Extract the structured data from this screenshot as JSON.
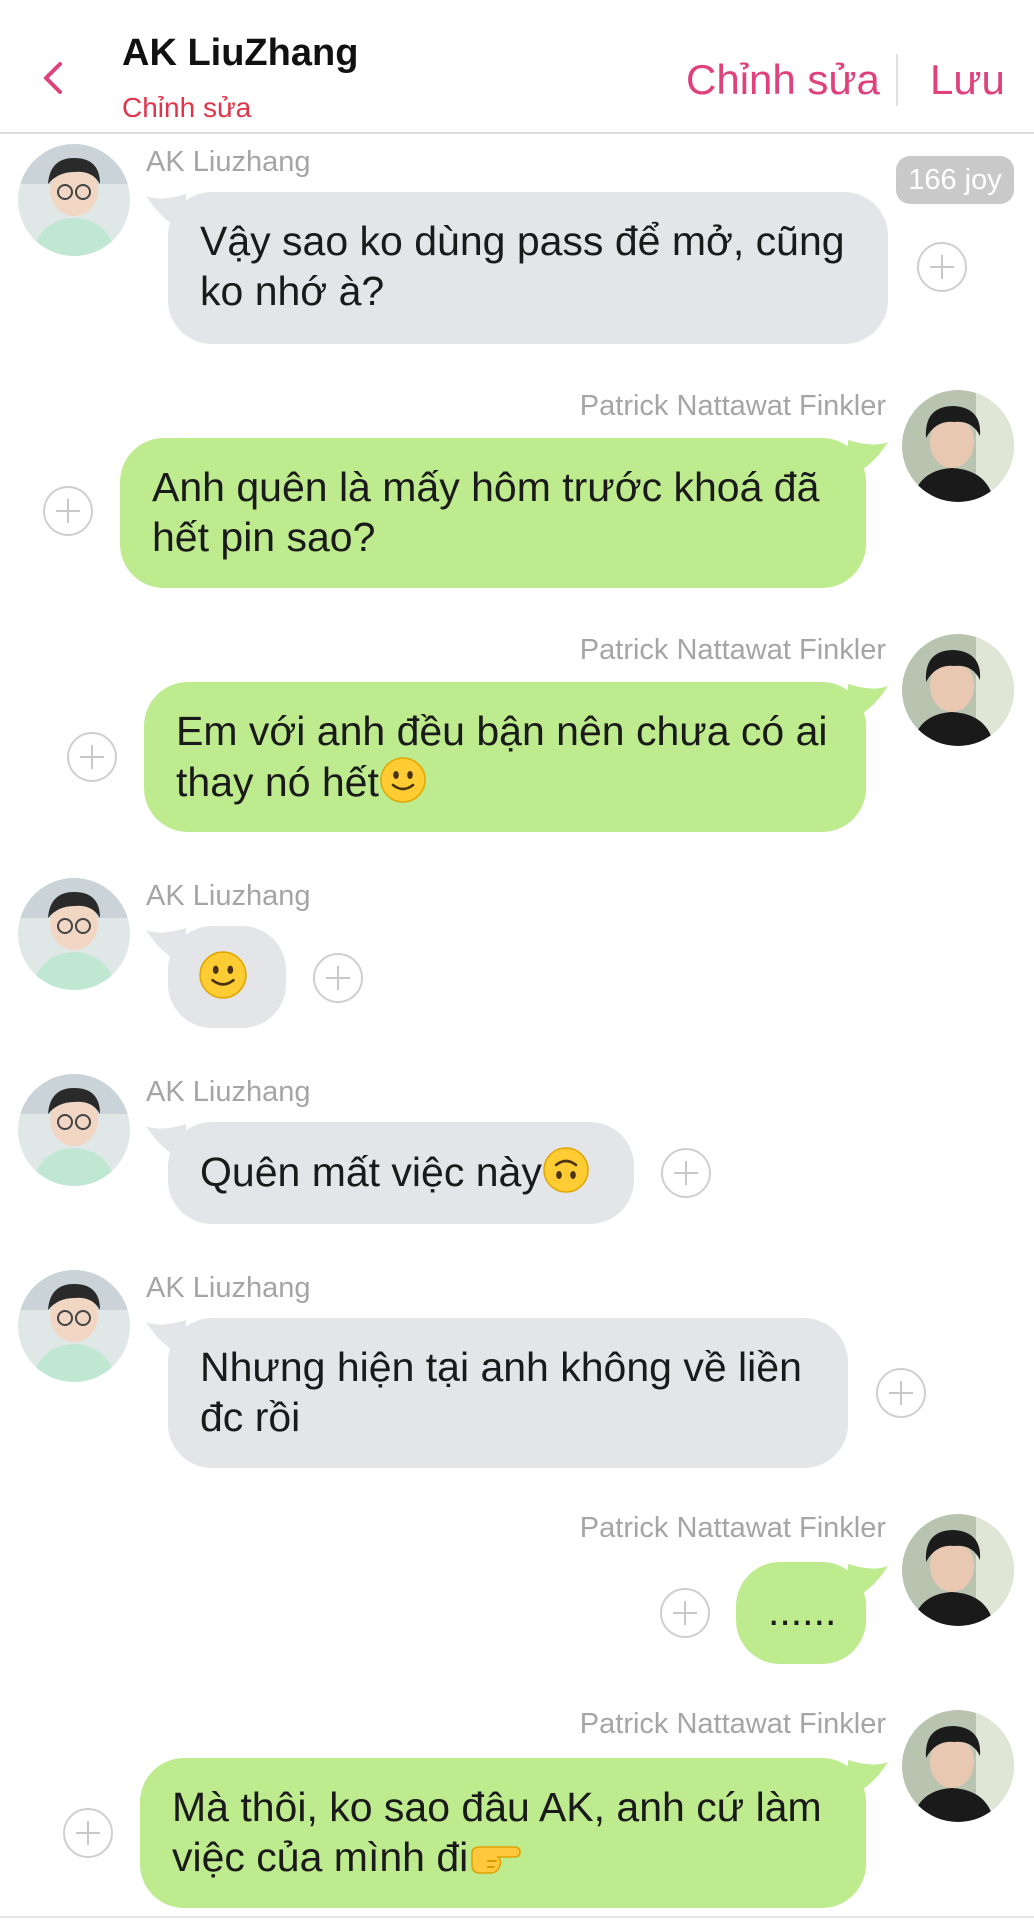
{
  "header": {
    "contact_name": "AK LiuZhang",
    "subtitle": "Chỉnh sửa",
    "edit_label": "Chỉnh sửa",
    "save_label": "Lưu"
  },
  "joy_badge": "166 joy",
  "messages": [
    {
      "sender": "AK Liuzhang",
      "side": "left",
      "lines": [
        "Vậy sao ko dùng pass để mở, cũng",
        "ko nhớ à?"
      ]
    },
    {
      "sender": "Patrick Nattawat Finkler",
      "side": "right",
      "lines": [
        "Anh quên là mấy hôm trước khoá đã",
        "hết pin sao?"
      ]
    },
    {
      "sender": "Patrick Nattawat Finkler",
      "side": "right",
      "lines": [
        "Em với anh đều bận nên chưa có ai",
        "thay nó hết"
      ],
      "emoji": "slightly-smiling-face"
    },
    {
      "sender": "AK Liuzhang",
      "side": "left",
      "lines": [],
      "emoji": "slightly-smiling-face"
    },
    {
      "sender": "AK Liuzhang",
      "side": "left",
      "lines": [
        "Quên mất việc này"
      ],
      "emoji": "upside-down-face"
    },
    {
      "sender": "AK Liuzhang",
      "side": "left",
      "lines": [
        "Nhưng hiện tại anh không về liền",
        "đc rồi"
      ]
    },
    {
      "sender": "Patrick Nattawat Finkler",
      "side": "right",
      "lines": [
        "......"
      ]
    },
    {
      "sender": "Patrick Nattawat Finkler",
      "side": "right",
      "lines": [
        "Mà thôi, ko sao đâu AK, anh cứ làm",
        "việc của mình đi"
      ],
      "emoji": "backhand-index-pointing-right"
    }
  ]
}
